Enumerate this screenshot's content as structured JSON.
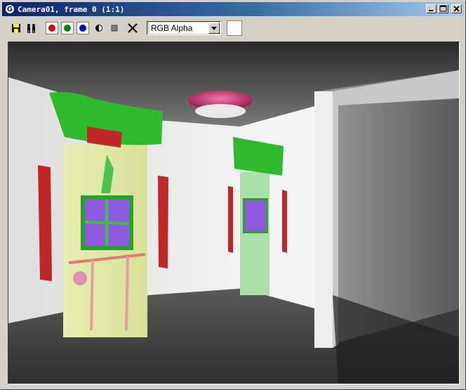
{
  "window": {
    "title": "Camera01, frame 0 (1:1)",
    "title_icon": "3ds-max-icon",
    "buttons": {
      "minimize": "minimize-icon",
      "maximize": "maximize-icon",
      "close": "close-icon"
    }
  },
  "toolbar": {
    "tools": [
      "save-icon",
      "clone-icon",
      "red-channel-icon",
      "green-channel-icon",
      "blue-channel-icon",
      "alpha-toggle-icon",
      "monochrome-icon",
      "clear-icon"
    ],
    "channel_select": {
      "value": "RGB Alpha"
    },
    "channel_colors": {
      "red": "#e00000",
      "green": "#008000",
      "blue": "#0000e0"
    },
    "swatch_color": "#ffffff"
  },
  "render": {
    "description_icon": "rendered-scene"
  }
}
